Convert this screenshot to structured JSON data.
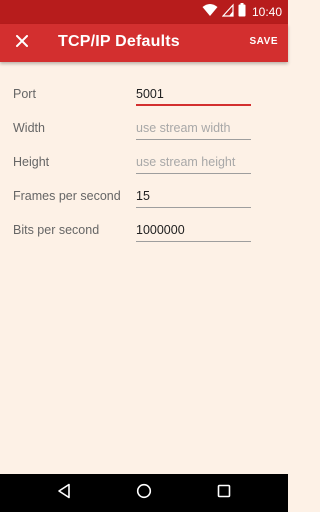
{
  "status_bar": {
    "time": "10:40",
    "icons": [
      "wifi-icon",
      "signal-icon",
      "battery-icon"
    ]
  },
  "app_bar": {
    "title": "TCP/IP Defaults",
    "close_icon": "close-icon",
    "save_label": "SAVE"
  },
  "form": {
    "port": {
      "label": "Port",
      "value": "5001",
      "placeholder": ""
    },
    "width": {
      "label": "Width",
      "value": "",
      "placeholder": "use stream width"
    },
    "height": {
      "label": "Height",
      "value": "",
      "placeholder": "use stream height"
    },
    "fps": {
      "label": "Frames per second",
      "value": "15",
      "placeholder": ""
    },
    "bps": {
      "label": "Bits per second",
      "value": "1000000",
      "placeholder": ""
    }
  },
  "nav_bar": {
    "icons": [
      "back-icon",
      "home-icon",
      "recents-icon"
    ]
  },
  "colors": {
    "status_bar": "#b71c1c",
    "app_bar": "#d32f2f",
    "background": "#fdf1e6",
    "accent": "#d32f2f"
  }
}
